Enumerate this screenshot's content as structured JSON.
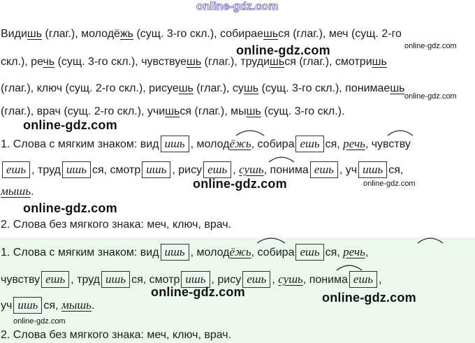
{
  "site_mark": "online-gdz.com",
  "watermark": "online-gdz.com",
  "task": {
    "l1": [
      "Види",
      "шь",
      " (глаг.), молодё",
      "жь",
      " (сущ. 3-го скл.), собирае",
      "шь",
      "ся (глаг.), меч (сущ. 2-го"
    ],
    "l2": [
      "скл.), ре",
      "чь",
      " (сущ. 3-го скл.), чувствуе",
      "шь",
      " (глаг.), труди",
      "шь",
      "ся (глаг.), смотри",
      "шь"
    ],
    "l3": [
      "(глаг.), ключ (сущ. 2-го скл.), рисуе",
      "шь",
      " (глаг.), су",
      "шь",
      " (сущ. 3-го скл.), понимае",
      "шь"
    ],
    "l4": [
      "(глаг.), врач (сущ. 2-го скл.), учи",
      "шь",
      "ся (глаг.), мы",
      "шь",
      " (сущ. 3-го скл.)."
    ]
  },
  "answer1": {
    "l1": [
      "1. Слова с мягким знаком: вид",
      "ишь",
      ", молод",
      "ёжь",
      ", собира",
      "ешь",
      "ся, ",
      "речь",
      ", чувству"
    ],
    "l2": [
      "ешь",
      ", труд",
      "ишь",
      "ся, смотр",
      "ишь",
      ", рису",
      "ешь",
      ", ",
      "сушь",
      ", понима",
      "ешь",
      ", уч",
      "ишь",
      "ся,"
    ],
    "l3": [
      "мышь",
      "."
    ],
    "l4": "2. Слова без мягкого знака: меч, ключ, врач."
  },
  "answer2": {
    "l1": [
      "1. Слова с мягким знаком: вид",
      "ишь",
      ", молод",
      "ёжь",
      ", собира",
      "ешь",
      "ся, ",
      "речь",
      ","
    ],
    "l2": [
      "чувству",
      "ешь",
      ", труд",
      "ишь",
      "ся, смотр",
      "ишь",
      ", рису",
      "ешь",
      ", ",
      "сушь",
      ", понима",
      "ешь",
      ","
    ],
    "l3": [
      "уч",
      "ишь",
      "ся, ",
      "мышь",
      "."
    ],
    "l4": "2. Слова без мягкого знака: меч, ключ, врач."
  }
}
